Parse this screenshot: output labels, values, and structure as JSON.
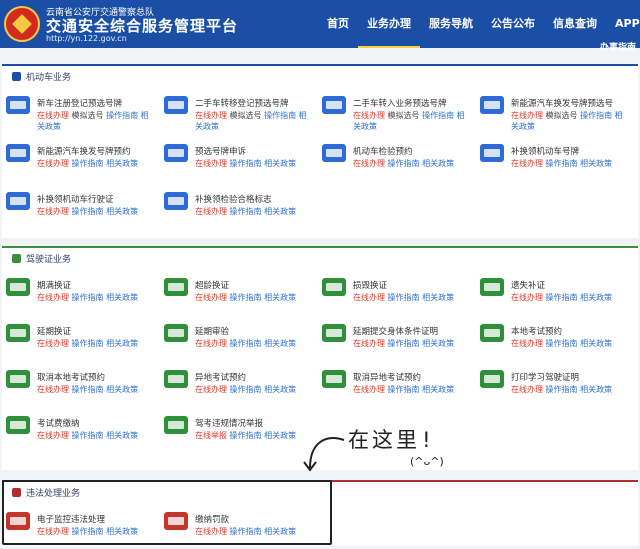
{
  "header": {
    "org": "云南省公安厅交通警察总队",
    "title": "交通安全综合服务管理平台",
    "url": "http://yn.122.gov.cn",
    "nav": [
      "首页",
      "业务办理",
      "服务导航",
      "公告公布",
      "信息查询",
      "APP下载"
    ],
    "active_nav": "业务办理",
    "dropdown_label": "办事指南"
  },
  "colors": {
    "header": "#1b4fa6",
    "accent_green": "#3a8f3a",
    "accent_red": "#b12e2e",
    "link_red": "#e03a2a",
    "link_blue": "#2f6fcf"
  },
  "sections": [
    {
      "title": "机动车业务",
      "items": [
        {
          "name": "新车注册登记预选号牌",
          "links": [
            "在线办理",
            "模拟选号",
            "操作指南",
            "相关政策"
          ]
        },
        {
          "name": "二手车转移登记预选号牌",
          "links": [
            "在线办理",
            "模拟选号",
            "操作指南",
            "相关政策"
          ]
        },
        {
          "name": "二手车转入业务预选号牌",
          "links": [
            "在线办理",
            "模拟选号",
            "操作指南",
            "相关政策"
          ]
        },
        {
          "name": "新能源汽车换发号牌预选号",
          "links": [
            "在线办理",
            "模拟选号",
            "操作指南",
            "相关政策"
          ]
        },
        {
          "name": "新能源汽车换发号牌预约",
          "links": [
            "在线办理",
            "操作指南",
            "相关政策"
          ]
        },
        {
          "name": "预选号牌申诉",
          "links": [
            "在线办理",
            "操作指南",
            "相关政策"
          ]
        },
        {
          "name": "机动车检验预约",
          "links": [
            "在线办理",
            "操作指南",
            "相关政策"
          ]
        },
        {
          "name": "补换领机动车号牌",
          "links": [
            "在线办理",
            "操作指南",
            "相关政策"
          ]
        },
        {
          "name": "补换领机动车行驶证",
          "links": [
            "在线办理",
            "操作指南",
            "相关政策"
          ]
        },
        {
          "name": "补换领检验合格标志",
          "links": [
            "在线办理",
            "操作指南",
            "相关政策"
          ]
        }
      ]
    },
    {
      "title": "驾驶证业务",
      "items": [
        {
          "name": "期满换证",
          "links": [
            "在线办理",
            "操作指南",
            "相关政策"
          ]
        },
        {
          "name": "超龄换证",
          "links": [
            "在线办理",
            "操作指南",
            "相关政策"
          ]
        },
        {
          "name": "损毁换证",
          "links": [
            "在线办理",
            "操作指南",
            "相关政策"
          ]
        },
        {
          "name": "遗失补证",
          "links": [
            "在线办理",
            "操作指南",
            "相关政策"
          ]
        },
        {
          "name": "延期换证",
          "links": [
            "在线办理",
            "操作指南",
            "相关政策"
          ]
        },
        {
          "name": "延期审验",
          "links": [
            "在线办理",
            "操作指南",
            "相关政策"
          ]
        },
        {
          "name": "延期提交身体条件证明",
          "links": [
            "在线办理",
            "操作指南",
            "相关政策"
          ]
        },
        {
          "name": "本地考试预约",
          "links": [
            "在线办理",
            "操作指南",
            "相关政策"
          ]
        },
        {
          "name": "取消本地考试预约",
          "links": [
            "在线办理",
            "操作指南",
            "相关政策"
          ]
        },
        {
          "name": "异地考试预约",
          "links": [
            "在线办理",
            "操作指南",
            "相关政策"
          ]
        },
        {
          "name": "取消异地考试预约",
          "links": [
            "在线办理",
            "操作指南",
            "相关政策"
          ]
        },
        {
          "name": "打印学习驾驶证明",
          "links": [
            "在线办理",
            "操作指南",
            "相关政策"
          ]
        },
        {
          "name": "考试费缴纳",
          "links": [
            "在线办理",
            "操作指南",
            "相关政策"
          ]
        },
        {
          "name": "驾考违规情况举报",
          "links": [
            "在线举报",
            "操作指南",
            "相关政策"
          ]
        }
      ]
    },
    {
      "title": "违法处理业务",
      "items": [
        {
          "name": "电子监控违法处理",
          "links": [
            "在线办理",
            "操作指南",
            "相关政策"
          ]
        },
        {
          "name": "缴纳罚款",
          "links": [
            "在线办理",
            "操作指南",
            "相关政策"
          ]
        }
      ]
    }
  ],
  "annotation": {
    "text": "在这里!",
    "emoji": "(^ᴗ^)"
  }
}
